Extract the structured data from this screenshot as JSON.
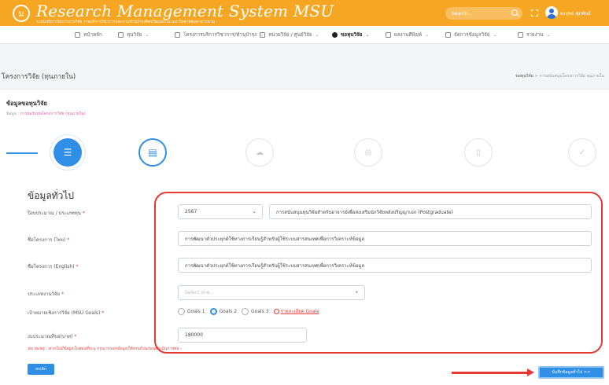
{
  "header": {
    "brand_title": "Research Management System MSU",
    "brand_subtitle": "ระบบบริหารจัดการงานวิจัย งานบริการวิชาการและงานทำนุบำรุงศิลปวัฒนธรรม มหาวิทยาลัยมหาสารคาม",
    "logo_glyph": "ม",
    "search_placeholder": "Search...",
    "user_name": "ยงยุทธ ศุภพันธ์"
  },
  "nav": {
    "items": [
      {
        "label": "หน้าหลัก",
        "icon": "home-icon",
        "dropdown": false
      },
      {
        "label": "ทุนวิจัย",
        "icon": "grid-icon",
        "dropdown": true
      },
      {
        "label": "โครงการบริการวิชาการ/ทำนุบำรุง",
        "icon": "folder-icon",
        "dropdown": true
      },
      {
        "label": "หน่วยวิจัย / ศูนย์วิจัย",
        "icon": "building-icon",
        "dropdown": true
      },
      {
        "label": "ขอทุนวิจัย",
        "icon": "target-icon",
        "dropdown": true,
        "active": true
      },
      {
        "label": "ผลงานตีพิมพ์",
        "icon": "book-icon",
        "dropdown": true
      },
      {
        "label": "จัดการข้อมูลวิจัย",
        "icon": "database-icon",
        "dropdown": true
      },
      {
        "label": "รายงาน",
        "icon": "chart-icon",
        "dropdown": true
      }
    ]
  },
  "page": {
    "title": "โครงการวิจัย (ทุนภายใน)",
    "breadcrumb_home": "ขอทุนวิจัย",
    "breadcrumb_sep": ">",
    "breadcrumb_current": "การสนับสนุนโครงการวิจัย ทุนภายใน"
  },
  "section": {
    "title": "ข้อมูลขอทุนวิจัย",
    "subtitle_prefix": "ข้อมูล :",
    "subtitle_highlight": "การขอรับทุนโครงการวิจัย (ทุนภายใน)"
  },
  "stepper": {
    "steps": [
      {
        "state": "active",
        "icon": "list-icon",
        "glyph": "☰"
      },
      {
        "state": "outline",
        "icon": "document-icon",
        "glyph": "▤"
      },
      {
        "state": "pending",
        "icon": "cloud-upload-icon",
        "glyph": "☁"
      },
      {
        "state": "pending",
        "icon": "coin-icon",
        "glyph": "◎"
      },
      {
        "state": "pending",
        "icon": "file-icon",
        "glyph": "▯"
      },
      {
        "state": "pending",
        "icon": "check-circle-icon",
        "glyph": "✓"
      }
    ]
  },
  "form": {
    "heading": "ข้อมูลทั่วไป",
    "year_label": "ปีงบประมาณ / ประเภททุน",
    "year_value": "2567",
    "fund_value": "การสนับสนุนทุนวิจัยสำหรับอาจารย์เพื่อส่งเสริมนักวิจัยหลังปริญญาเอก (Postgraduate)",
    "title_th_label": "ชื่อโครงการ (ไทย)",
    "title_th_value": "การพัฒนาตัวประยุกต์ใช้ทางการเรียนรู้สำหรับผู้ใช้ระบบสารสนเทศเพื่อการวิเคราะห์ข้อมูล",
    "title_en_label": "ชื่อโครงการ (English)",
    "title_en_value": "การพัฒนาตัวประยุกต์ใช้ทางการเรียนรู้สำหรับผู้ใช้ระบบสารสนเทศเพื่อการวิเคราะห์ข้อมูล",
    "type_label": "ประเภทงานวิจัย",
    "type_placeholder": "Select one...",
    "goals_label": "เป้าหมายเชิงการวิจัย (MSU Goals)",
    "goals": [
      "Goals 1",
      "Goals 2",
      "Goals 3"
    ],
    "goals_selected": "Goals 2",
    "goals_link": "รายละเอียด Goals",
    "budget_label": "งบประมาณที่ขอ(บาท)",
    "budget_value": "180000",
    "required_mark": "*",
    "note": "หมายเหตุ : หากไม่มีข้อมูลในช่องที่ระบุ กรุณากรอกข้อมูลให้ครบถ้วนก่อนดำเนินการต่อ -"
  },
  "actions": {
    "back_label": "ยกเลิก",
    "next_label": "บันทึกข้อมูลทั่วไป >>"
  },
  "colors": {
    "brand": "#f5a623",
    "primary": "#2f8ee6",
    "annotation": "#e53935"
  }
}
